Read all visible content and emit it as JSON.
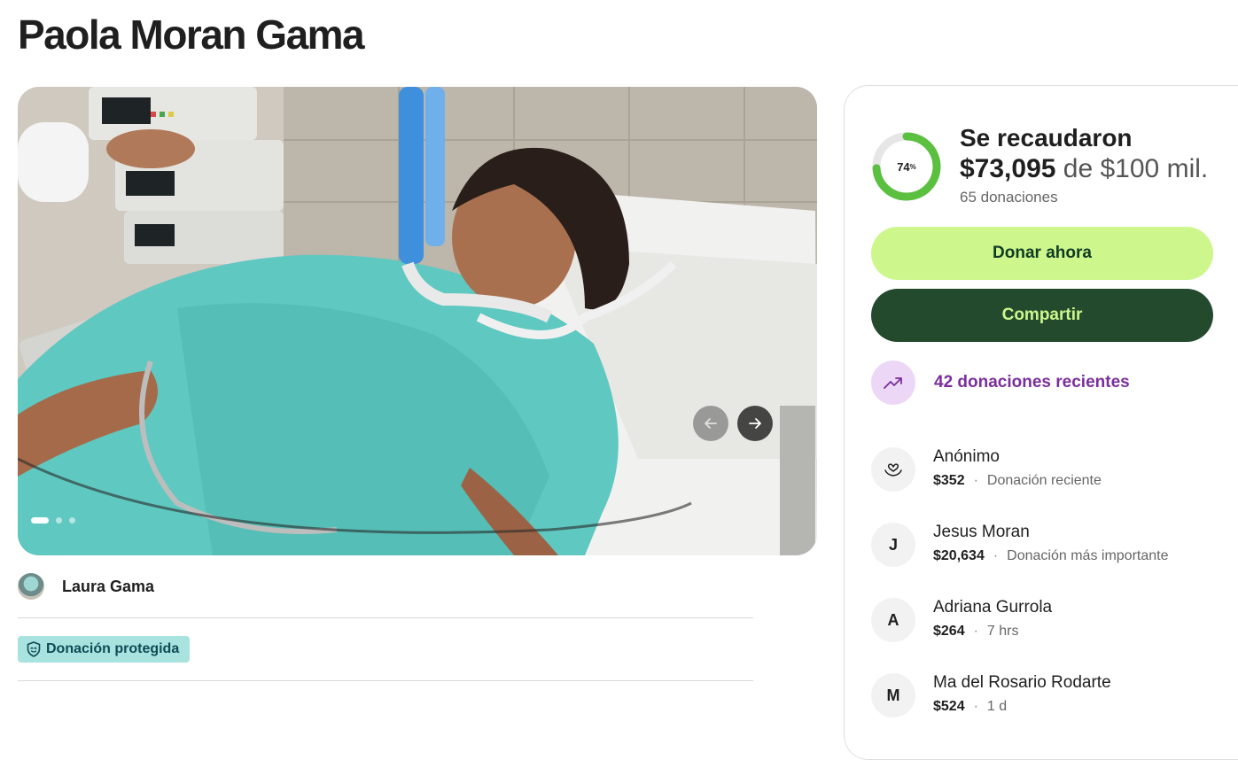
{
  "page": {
    "title": "Paola Moran Gama"
  },
  "gallery": {
    "active_index": 0,
    "total": 3,
    "prev_icon": "arrow-left-icon",
    "next_icon": "arrow-right-icon"
  },
  "organizer": {
    "name": "Laura Gama"
  },
  "badge": {
    "label": "Donación protegida",
    "icon": "shield-icon"
  },
  "summary": {
    "percent": 74,
    "percent_text": "74",
    "percent_sign": "%",
    "raised_title": "Se recaudaron",
    "amount": "$73,095",
    "goal_text": "de $100 mil.",
    "donations_count": "65 donaciones"
  },
  "actions": {
    "donate_label": "Donar ahora",
    "share_label": "Compartir"
  },
  "recent": {
    "label": "42 donaciones recientes",
    "icon": "trending-up-icon"
  },
  "donors": [
    {
      "initial": "",
      "icon": "heart-hand-icon",
      "name": "Anónimo",
      "amount": "$352",
      "note": "Donación reciente"
    },
    {
      "initial": "J",
      "name": "Jesus Moran",
      "amount": "$20,634",
      "note": "Donación más importante"
    },
    {
      "initial": "A",
      "name": "Adriana Gurrola",
      "amount": "$264",
      "note": "7 hrs"
    },
    {
      "initial": "M",
      "name": "Ma del Rosario Rodarte",
      "amount": "$524",
      "note": "1 d"
    }
  ],
  "colors": {
    "accent_green": "#cdf78c",
    "dark_green": "#244a2e",
    "progress_green": "#5bbf3f",
    "purple": "#7b2e9c",
    "badge_bg": "#a8e3e0"
  }
}
